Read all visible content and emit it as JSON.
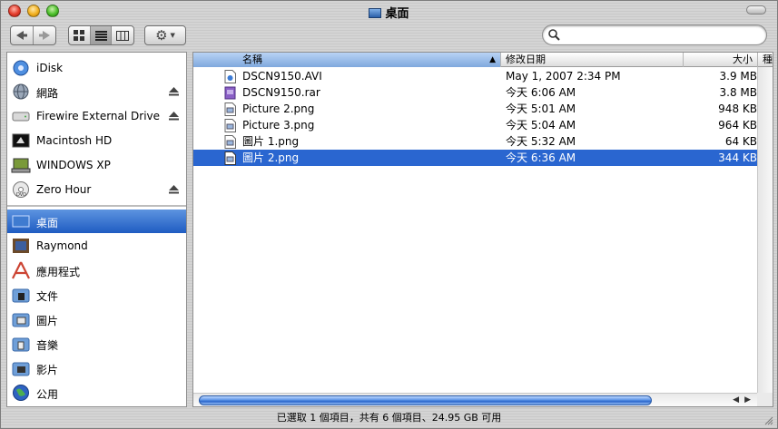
{
  "window": {
    "title": "桌面"
  },
  "toolbar": {
    "back": "back-arrow",
    "forward": "forward-arrow",
    "views": [
      "icon-view",
      "list-view",
      "column-view"
    ],
    "action": "gear-menu",
    "search": {
      "value": "",
      "placeholder": ""
    }
  },
  "sidebar": {
    "devices": [
      {
        "label": "iDisk",
        "icon": "idisk-icon",
        "eject": false
      },
      {
        "label": "網路",
        "icon": "network-icon",
        "eject": true
      },
      {
        "label": "Firewire External Drive",
        "icon": "external-drive-icon",
        "eject": true
      },
      {
        "label": "Macintosh HD",
        "icon": "hard-disk-icon",
        "eject": false
      },
      {
        "label": "WINDOWS XP",
        "icon": "windows-disk-icon",
        "eject": false
      },
      {
        "label": "Zero Hour",
        "icon": "dvd-icon",
        "eject": true
      }
    ],
    "places": [
      {
        "label": "桌面",
        "icon": "desktop-icon",
        "selected": true
      },
      {
        "label": "Raymond",
        "icon": "home-icon",
        "selected": false
      },
      {
        "label": "應用程式",
        "icon": "applications-icon",
        "selected": false
      },
      {
        "label": "文件",
        "icon": "documents-folder-icon",
        "selected": false
      },
      {
        "label": "圖片",
        "icon": "pictures-folder-icon",
        "selected": false
      },
      {
        "label": "音樂",
        "icon": "music-folder-icon",
        "selected": false
      },
      {
        "label": "影片",
        "icon": "movies-folder-icon",
        "selected": false
      },
      {
        "label": "公用",
        "icon": "public-folder-icon",
        "selected": false
      }
    ]
  },
  "filelist": {
    "columns": {
      "name": "名稱",
      "date": "修改日期",
      "size": "大小",
      "kind": "種類"
    },
    "rows": [
      {
        "name": "DSCN9150.AVI",
        "date": "May 1, 2007 2:34 PM",
        "size": "3.9 MB",
        "icon": "movie-file-icon",
        "selected": false
      },
      {
        "name": "DSCN9150.rar",
        "date": "今天 6:06 AM",
        "size": "3.8 MB",
        "icon": "archive-file-icon",
        "selected": false
      },
      {
        "name": "Picture 2.png",
        "date": "今天 5:01 AM",
        "size": "948 KB",
        "icon": "png-file-icon",
        "selected": false
      },
      {
        "name": "Picture 3.png",
        "date": "今天 5:04 AM",
        "size": "964 KB",
        "icon": "png-file-icon",
        "selected": false
      },
      {
        "name": "圖片 1.png",
        "date": "今天 5:32 AM",
        "size": "64 KB",
        "icon": "png-file-icon",
        "selected": false
      },
      {
        "name": "圖片 2.png",
        "date": "今天 6:36 AM",
        "size": "344 KB",
        "icon": "png-file-icon",
        "selected": true
      }
    ]
  },
  "status": {
    "text": "已選取 1 個項目，共有 6 個項目、24.95 GB 可用"
  },
  "colors": {
    "selection": "#2a66d0",
    "sidebar_selection": "#3a74d4"
  }
}
